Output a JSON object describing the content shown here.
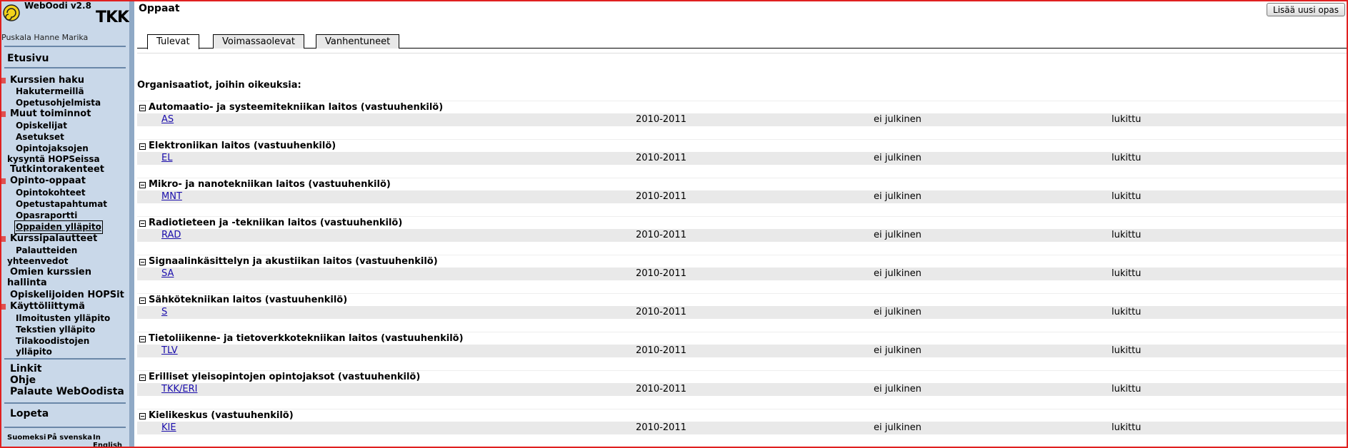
{
  "sidebar": {
    "app_title": "WebOodi v2.8",
    "brand": "TKK",
    "user": "Puskala Hanne Marika",
    "home": "Etusivu",
    "course_search": "Kurssien haku",
    "search_terms": "Hakutermeillä",
    "curricula": "Opetusohjelmista",
    "other_functions": "Muut toiminnot",
    "students": "Opiskelijat",
    "settings": "Asetukset",
    "course_demand": "Opintojaksojen kysyntä HOPSeissa",
    "degree_structures": "Tutkintorakenteet",
    "study_guides": "Opinto-oppaat",
    "study_targets": "Opintokohteet",
    "teaching_events": "Opetustapahtumat",
    "guide_report": "Opasraportti",
    "guide_maintenance": "Oppaiden ylläpito",
    "course_feedback": "Kurssipalautteet",
    "feedback_summaries": "Palautteiden yhteenvedot",
    "own_courses": "Omien kurssien hallinta",
    "student_hops": "Opiskelijoiden HOPSit",
    "ui": "Käyttöliittymä",
    "notice_maintenance": "Ilmoitusten ylläpito",
    "text_maintenance": "Tekstien ylläpito",
    "room_code_maintenance": "Tilakoodistojen ylläpito",
    "links": "Linkit",
    "help": "Ohje",
    "feedback": "Palaute WebOodista",
    "logout": "Lopeta",
    "lang_fi": "Suomeksi",
    "lang_sv": "På svenska",
    "lang_en": "In English"
  },
  "main": {
    "title": "Oppaat",
    "add_button": "Lisää uusi opas",
    "tabs": [
      "Tulevat",
      "Voimassaolevat",
      "Vanhentuneet"
    ],
    "org_caption": "Organisaatiot, joihin oikeuksia:",
    "orgs": [
      {
        "name": "Automaatio- ja systeemitekniikan laitos (vastuuhenkilö)",
        "code": "AS",
        "year": "2010-2011",
        "public": "ei julkinen",
        "lock": "lukittu"
      },
      {
        "name": "Elektroniikan laitos (vastuuhenkilö)",
        "code": "EL",
        "year": "2010-2011",
        "public": "ei julkinen",
        "lock": "lukittu"
      },
      {
        "name": "Mikro- ja nanotekniikan laitos (vastuuhenkilö)",
        "code": "MNT",
        "year": "2010-2011",
        "public": "ei julkinen",
        "lock": "lukittu"
      },
      {
        "name": "Radiotieteen ja -tekniikan laitos (vastuuhenkilö)",
        "code": "RAD",
        "year": "2010-2011",
        "public": "ei julkinen",
        "lock": "lukittu"
      },
      {
        "name": "Signaalinkäsittelyn ja akustiikan laitos (vastuuhenkilö)",
        "code": "SA",
        "year": "2010-2011",
        "public": "ei julkinen",
        "lock": "lukittu"
      },
      {
        "name": "Sähkötekniikan laitos (vastuuhenkilö)",
        "code": "S",
        "year": "2010-2011",
        "public": "ei julkinen",
        "lock": "lukittu"
      },
      {
        "name": "Tietoliikenne- ja tietoverkkotekniikan laitos (vastuuhenkilö)",
        "code": "TLV",
        "year": "2010-2011",
        "public": "ei julkinen",
        "lock": "lukittu"
      },
      {
        "name": "Erilliset yleisopintojen opintojaksot (vastuuhenkilö)",
        "code": "TKK/ERI",
        "year": "2010-2011",
        "public": "ei julkinen",
        "lock": "lukittu"
      },
      {
        "name": "Kielikeskus (vastuuhenkilö)",
        "code": "KIE",
        "year": "2010-2011",
        "public": "ei julkinen",
        "lock": "lukittu"
      }
    ]
  }
}
